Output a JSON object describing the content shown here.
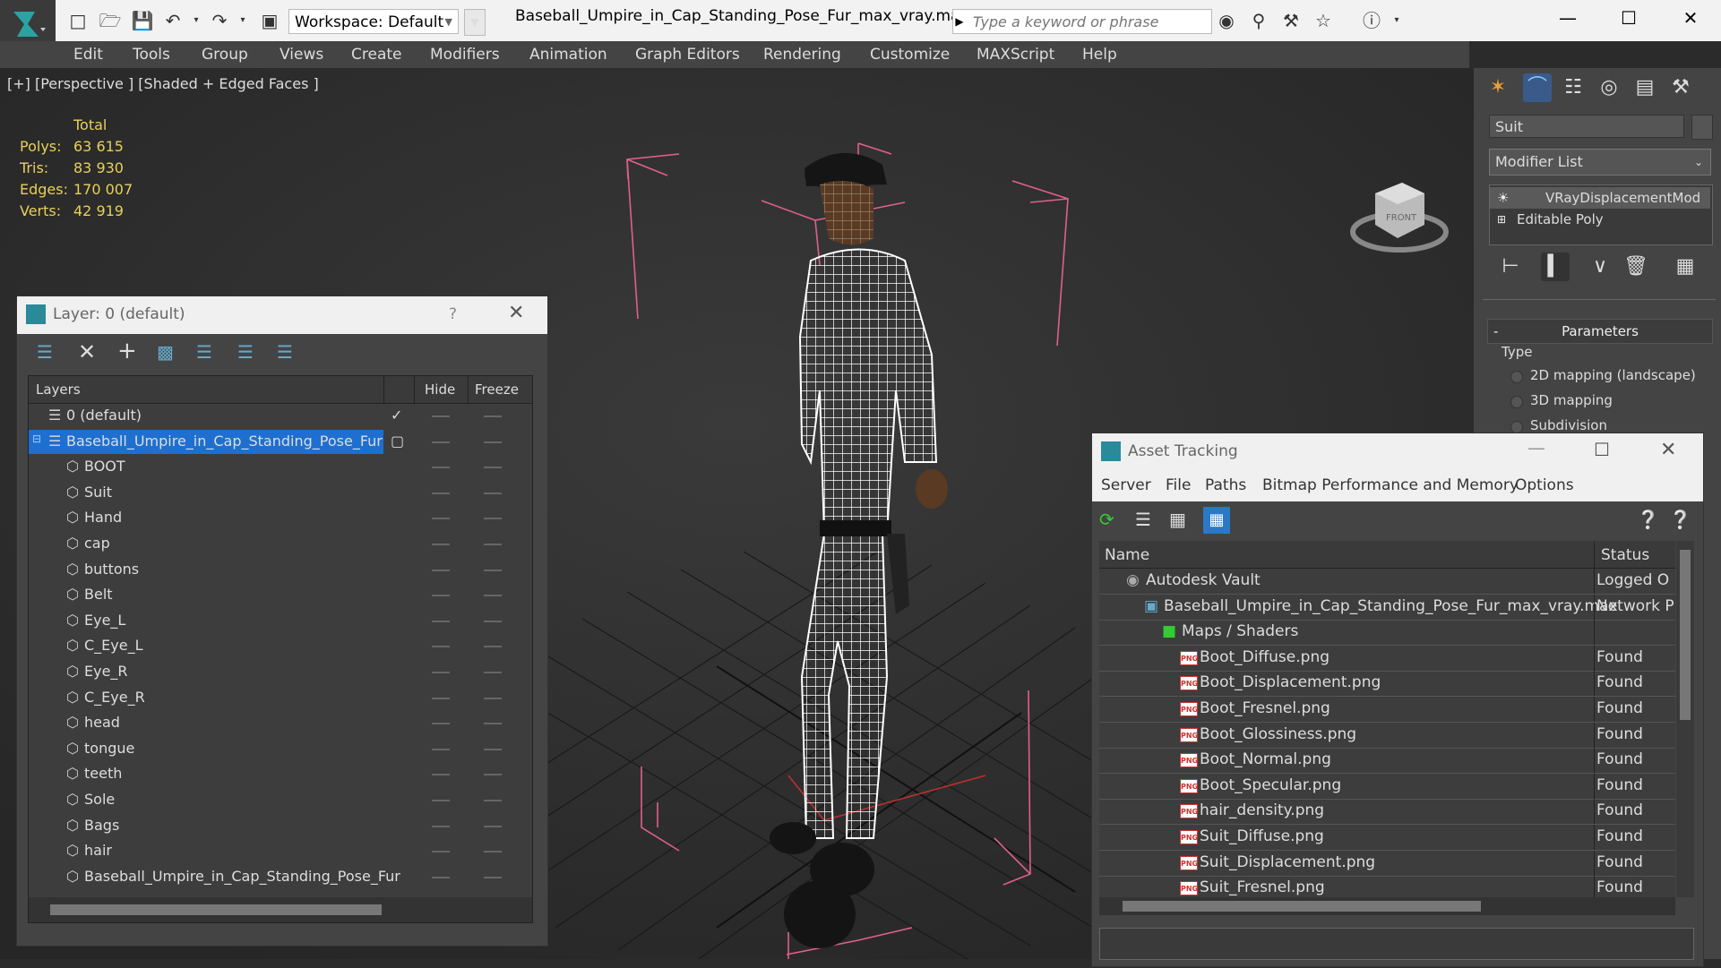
{
  "titlebar": {
    "workspace": "Workspace: Default",
    "document_title": "Baseball_Umpire_in_Cap_Standing_Pose_Fur_max_vray.max",
    "search_placeholder": "Type a keyword or phrase"
  },
  "menubar": [
    "Edit",
    "Tools",
    "Group",
    "Views",
    "Create",
    "Modifiers",
    "Animation",
    "Graph Editors",
    "Rendering",
    "Customize",
    "MAXScript",
    "Help"
  ],
  "viewport": {
    "label": "[+] [Perspective ] [Shaded + Edged Faces ]",
    "stats": {
      "header": "Total",
      "rows": [
        {
          "label": "Polys:",
          "value": "63 615"
        },
        {
          "label": "Tris:",
          "value": "83 930"
        },
        {
          "label": "Edges:",
          "value": "170 007"
        },
        {
          "label": "Verts:",
          "value": "42 919"
        }
      ]
    },
    "viewcube_label": "FRONT"
  },
  "command_panel": {
    "object_name": "Suit",
    "modifier_list": "Modifier List",
    "stack": [
      "VRayDisplacementMod",
      "Editable Poly"
    ],
    "params_title": "Parameters",
    "type_label": "Type",
    "type_options": [
      "2D mapping (landscape)",
      "3D mapping",
      "Subdivision"
    ]
  },
  "layer_dialog": {
    "title": "Layer: 0 (default)",
    "help": "?",
    "col_layers": "Layers",
    "col_hide": "Hide",
    "col_freeze": "Freeze",
    "layers": [
      {
        "name": "0 (default)",
        "level": 0,
        "kind": "layer"
      },
      {
        "name": "Baseball_Umpire_in_Cap_Standing_Pose_Fur",
        "level": 0,
        "kind": "layer",
        "selected": true
      },
      {
        "name": "BOOT",
        "level": 1,
        "kind": "object"
      },
      {
        "name": "Suit",
        "level": 1,
        "kind": "object"
      },
      {
        "name": "Hand",
        "level": 1,
        "kind": "object"
      },
      {
        "name": "cap",
        "level": 1,
        "kind": "object"
      },
      {
        "name": "buttons",
        "level": 1,
        "kind": "object"
      },
      {
        "name": "Belt",
        "level": 1,
        "kind": "object"
      },
      {
        "name": "Eye_L",
        "level": 1,
        "kind": "object"
      },
      {
        "name": "C_Eye_L",
        "level": 1,
        "kind": "object"
      },
      {
        "name": "Eye_R",
        "level": 1,
        "kind": "object"
      },
      {
        "name": "C_Eye_R",
        "level": 1,
        "kind": "object"
      },
      {
        "name": "head",
        "level": 1,
        "kind": "object"
      },
      {
        "name": "tongue",
        "level": 1,
        "kind": "object"
      },
      {
        "name": "teeth",
        "level": 1,
        "kind": "object"
      },
      {
        "name": "Sole",
        "level": 1,
        "kind": "object"
      },
      {
        "name": "Bags",
        "level": 1,
        "kind": "object"
      },
      {
        "name": "hair",
        "level": 1,
        "kind": "object"
      },
      {
        "name": "Baseball_Umpire_in_Cap_Standing_Pose_Fur",
        "level": 1,
        "kind": "object"
      }
    ]
  },
  "asset_dialog": {
    "title": "Asset Tracking",
    "menu": [
      "Server",
      "File",
      "Paths",
      "Bitmap Performance and Memory",
      "Options"
    ],
    "col_name": "Name",
    "col_status": "Status",
    "rows": [
      {
        "name": "Autodesk Vault",
        "status": "Logged O",
        "level": 1,
        "icon": "vault"
      },
      {
        "name": "Baseball_Umpire_in_Cap_Standing_Pose_Fur_max_vray.max",
        "status": "Network P",
        "level": 2,
        "icon": "max"
      },
      {
        "name": "Maps / Shaders",
        "status": "",
        "level": 3,
        "icon": "maps"
      },
      {
        "name": "Boot_Diffuse.png",
        "status": "Found",
        "level": 4,
        "icon": "png"
      },
      {
        "name": "Boot_Displacement.png",
        "status": "Found",
        "level": 4,
        "icon": "png"
      },
      {
        "name": "Boot_Fresnel.png",
        "status": "Found",
        "level": 4,
        "icon": "png"
      },
      {
        "name": "Boot_Glossiness.png",
        "status": "Found",
        "level": 4,
        "icon": "png"
      },
      {
        "name": "Boot_Normal.png",
        "status": "Found",
        "level": 4,
        "icon": "png"
      },
      {
        "name": "Boot_Specular.png",
        "status": "Found",
        "level": 4,
        "icon": "png"
      },
      {
        "name": "hair_density.png",
        "status": "Found",
        "level": 4,
        "icon": "png"
      },
      {
        "name": "Suit_Diffuse.png",
        "status": "Found",
        "level": 4,
        "icon": "png"
      },
      {
        "name": "Suit_Displacement.png",
        "status": "Found",
        "level": 4,
        "icon": "png"
      },
      {
        "name": "Suit_Fresnel.png",
        "status": "Found",
        "level": 4,
        "icon": "png"
      }
    ]
  },
  "colors": {
    "accent": "#1e6fd0",
    "stat_text": "#e8d05a",
    "bounding_box": "#e0608a"
  }
}
